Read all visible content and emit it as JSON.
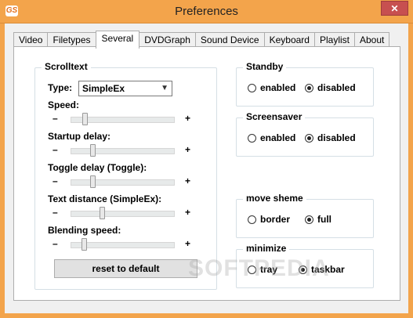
{
  "window": {
    "title": "Preferences",
    "app_icon_text": "GS",
    "close": "✕"
  },
  "tabs": [
    "Video",
    "Filetypes",
    "Several",
    "DVDGraph",
    "Sound Device",
    "Keyboard",
    "Playlist",
    "About"
  ],
  "scrolltext": {
    "legend": "Scrolltext",
    "type_label": "Type:",
    "type_value": "SimpleEx",
    "sliders": [
      {
        "label": "Speed:",
        "value": 0.12
      },
      {
        "label": "Startup delay:",
        "value": 0.2
      },
      {
        "label": "Toggle delay (Toggle):",
        "value": 0.2
      },
      {
        "label": "Text distance (SimpleEx):",
        "value": 0.29
      },
      {
        "label": "Blending speed:",
        "value": 0.11
      }
    ],
    "minus": "–",
    "plus": "+",
    "reset_label": "reset to default"
  },
  "standby": {
    "legend": "Standby",
    "options": [
      "enabled",
      "disabled"
    ],
    "selected": "disabled"
  },
  "screensaver": {
    "legend": "Screensaver",
    "options": [
      "enabled",
      "disabled"
    ],
    "selected": "disabled"
  },
  "move_scheme": {
    "legend": "move sheme",
    "options": [
      "border",
      "full"
    ],
    "selected": "full"
  },
  "minimize": {
    "legend": "minimize",
    "options": [
      "tray",
      "taskbar"
    ],
    "selected": "taskbar"
  },
  "watermark": "SOFTPEDIA"
}
